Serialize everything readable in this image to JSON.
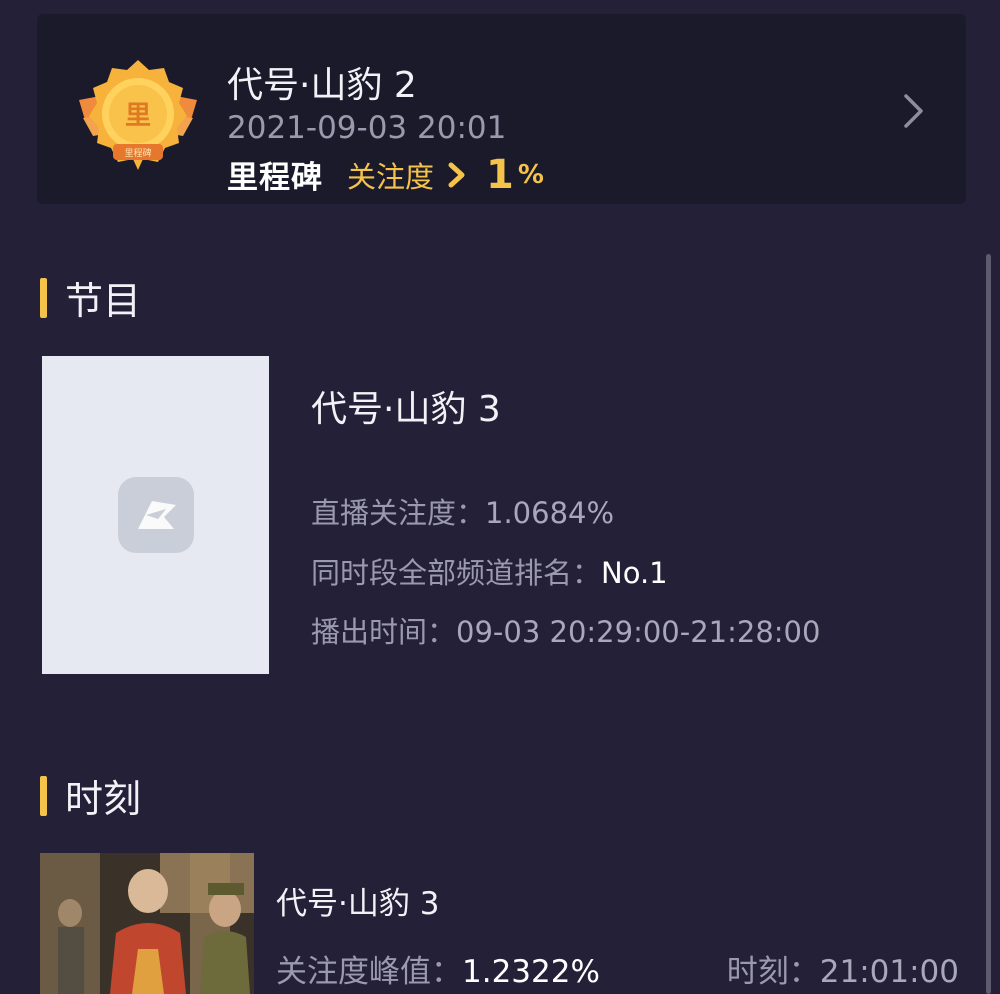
{
  "milestone": {
    "title": "代号·山豹 2",
    "datetime": "2021-09-03 20:01",
    "badge_word": "里程碑",
    "metric_label": "关注度",
    "metric_value": "1",
    "metric_unit": "%",
    "medal_text": "里",
    "medal_ribbon_text": "里程碑"
  },
  "program_section": {
    "heading": "节目",
    "title": "代号·山豹 3",
    "rows": [
      {
        "label": "直播关注度：",
        "value": "1.0684%"
      },
      {
        "label": "同时段全部频道排名：",
        "value": "No.1"
      },
      {
        "label": "播出时间：",
        "value": "09-03 20:29:00-21:28:00"
      }
    ]
  },
  "moment_section": {
    "heading": "时刻",
    "title": "代号·山豹 3",
    "peak_label": "关注度峰值：",
    "peak_value": "1.2322%",
    "time_label": "时刻：",
    "time_value": "21:01:00"
  },
  "colors": {
    "background": "#232038",
    "card": "#1b1a2b",
    "accent": "#f5c24a",
    "muted_text": "#9b99ad"
  },
  "icons": {
    "medal": "milestone-medal-icon",
    "metric_arrow": "chevron-right-icon",
    "card_arrow": "chevron-right-icon",
    "poster_placeholder": "placeholder-logo-icon"
  }
}
